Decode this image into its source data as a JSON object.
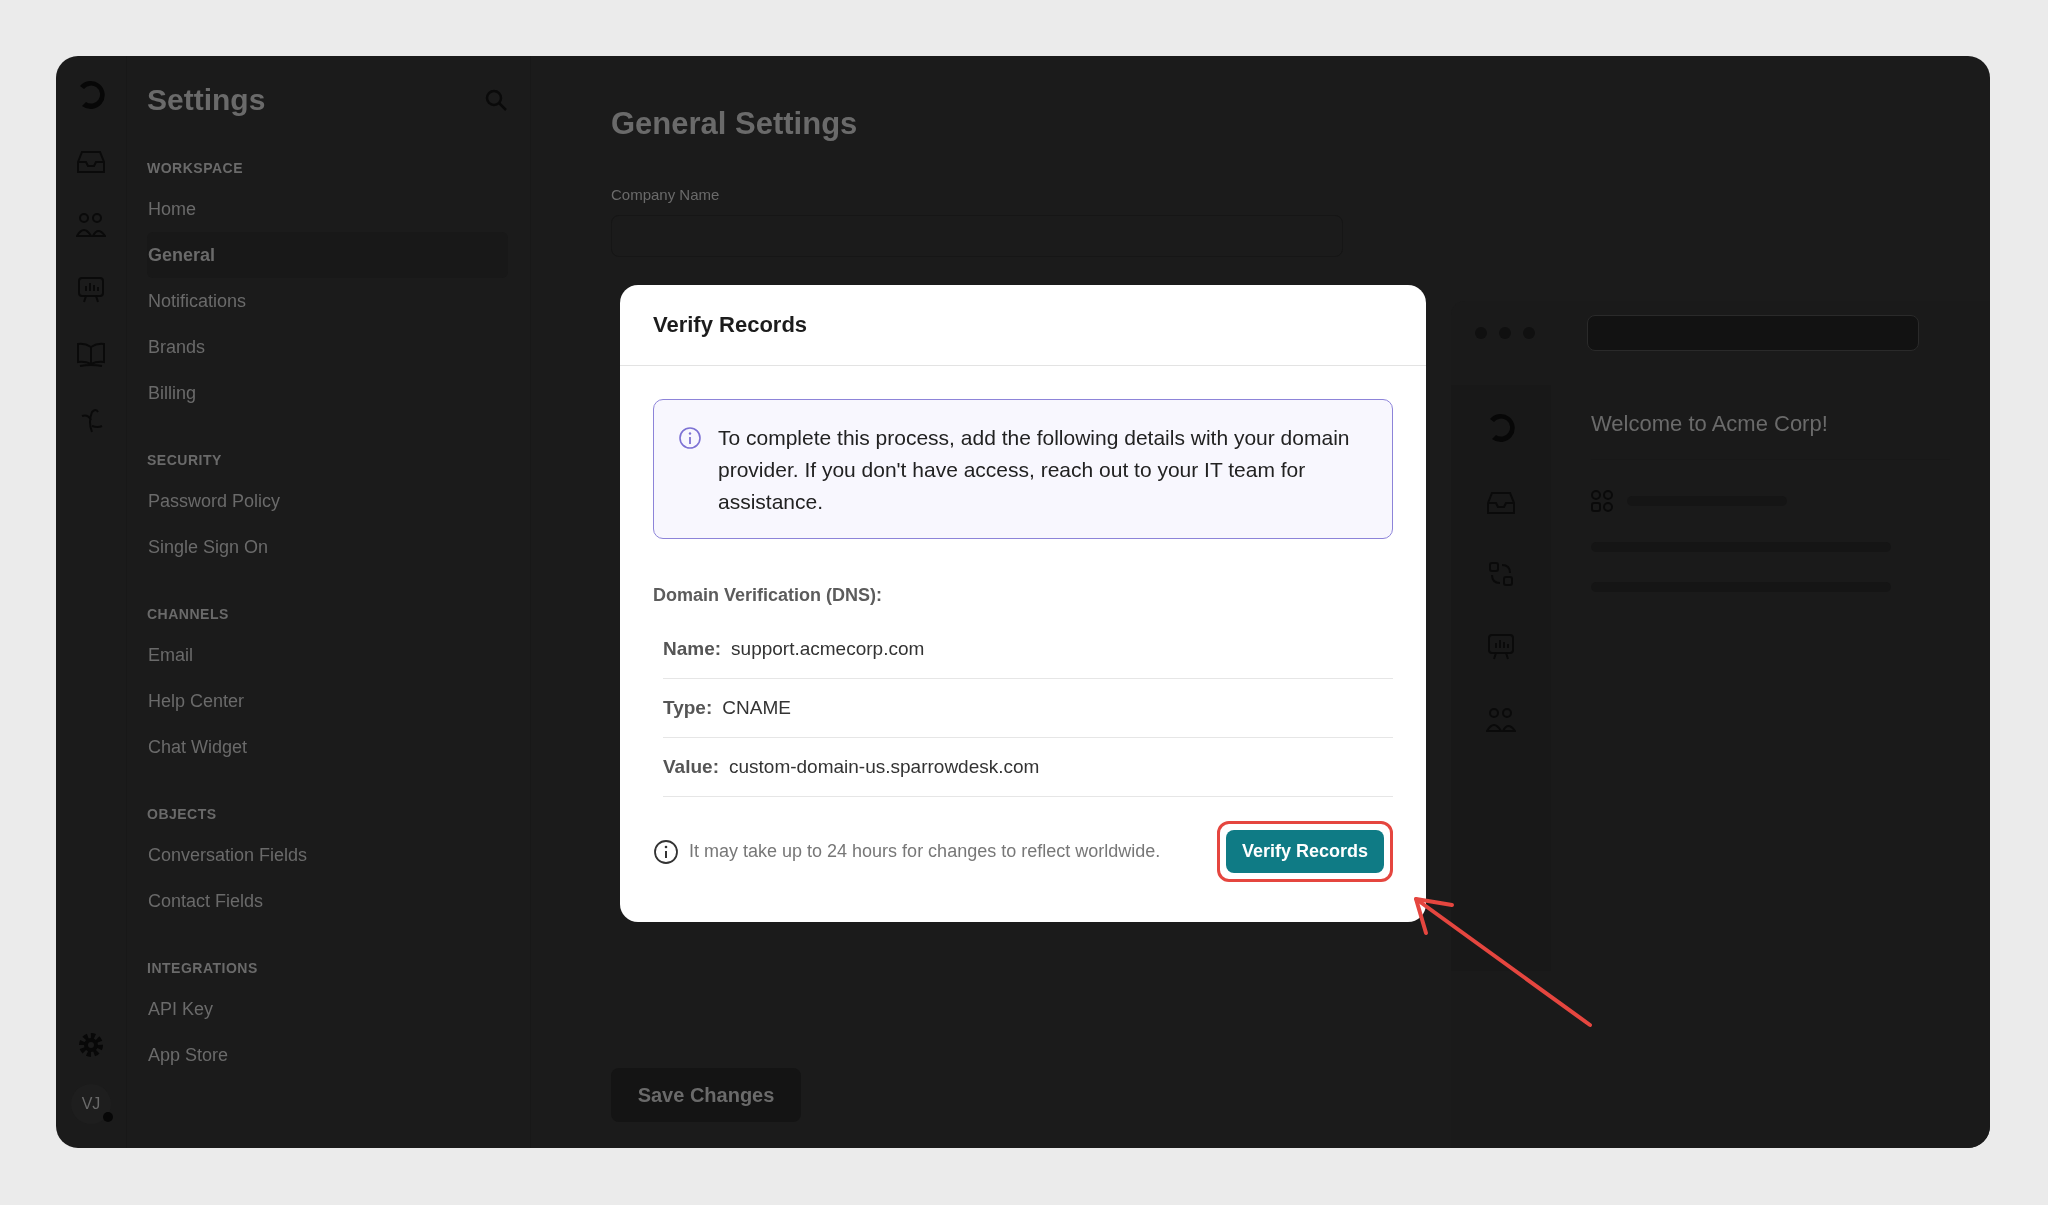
{
  "app_rail": {
    "avatar": "VJ",
    "online": true
  },
  "sidebar": {
    "title": "Settings",
    "sections": [
      {
        "heading": "WORKSPACE",
        "items": [
          {
            "label": "Home",
            "selected": false
          },
          {
            "label": "General",
            "selected": true
          },
          {
            "label": "Notifications",
            "selected": false
          },
          {
            "label": "Brands",
            "selected": false
          },
          {
            "label": "Billing",
            "selected": false
          }
        ]
      },
      {
        "heading": "SECURITY",
        "items": [
          {
            "label": "Password Policy",
            "selected": false
          },
          {
            "label": "Single Sign On",
            "selected": false
          }
        ]
      },
      {
        "heading": "CHANNELS",
        "items": [
          {
            "label": "Email",
            "selected": false
          },
          {
            "label": "Help Center",
            "selected": false
          },
          {
            "label": "Chat Widget",
            "selected": false
          }
        ]
      },
      {
        "heading": "OBJECTS",
        "items": [
          {
            "label": "Conversation Fields",
            "selected": false
          },
          {
            "label": "Contact Fields",
            "selected": false
          }
        ]
      },
      {
        "heading": "INTEGRATIONS",
        "items": [
          {
            "label": "API Key",
            "selected": false
          },
          {
            "label": "App Store",
            "selected": false
          }
        ]
      }
    ]
  },
  "main": {
    "title": "General Settings",
    "company_name": {
      "label": "Company Name"
    },
    "save_button": "Save Changes",
    "preview": {
      "welcome": "Welcome to Acme Corp!"
    }
  },
  "dialog": {
    "title": "Verify Records",
    "notice": "To complete this process, add the following details with your domain provider. If you don't have access, reach out to your IT team for assistance.",
    "section_label": "Domain Verification (DNS):",
    "records": [
      {
        "label": "Name:",
        "value": "support.acmecorp.com"
      },
      {
        "label": "Type:",
        "value": "CNAME"
      },
      {
        "label": "Value:",
        "value": "custom-domain-us.sparrowdesk.com"
      }
    ],
    "footnote": "It may take up to 24 hours for changes to reflect worldwide.",
    "button": "Verify Records",
    "highlighted": true
  }
}
